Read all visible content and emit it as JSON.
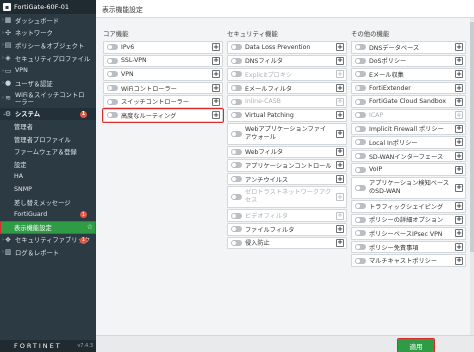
{
  "sidebar": {
    "device": "FortiGate-60F-01",
    "items": [
      {
        "label": "ダッシュボード",
        "icon": "dashboard-icon"
      },
      {
        "label": "ネットワーク",
        "icon": "network-icon"
      },
      {
        "label": "ポリシー＆オブジェクト",
        "icon": "policy-icon"
      },
      {
        "label": "セキュリティプロファイル",
        "icon": "shield-icon"
      },
      {
        "label": "VPN",
        "icon": "vpn-icon"
      },
      {
        "label": "ユーザ＆認証",
        "icon": "user-icon"
      },
      {
        "label": "WiFi＆スイッチコントローラー",
        "icon": "wifi-icon"
      }
    ],
    "system": {
      "label": "システム",
      "badge": "1"
    },
    "system_sub": [
      "管理者",
      "管理者プロファイル",
      "ファームウェア＆登録",
      "設定",
      "HA",
      "SNMP",
      "差し替えメッセージ",
      "FortiGuard"
    ],
    "fortiguard_badge": "1",
    "current": "表示機能設定",
    "bottom": [
      {
        "label": "セキュリティファブリック",
        "icon": "fabric-icon",
        "badge": "1"
      },
      {
        "label": "ログ＆レポート",
        "icon": "log-icon"
      }
    ],
    "footer_logo": "FORTINET",
    "version": "v7.4.3"
  },
  "main": {
    "title": "表示機能設定",
    "columns": [
      {
        "title": "コア機能",
        "features": [
          {
            "label": "IPv6",
            "on": false,
            "disabled": false
          },
          {
            "label": "SSL-VPN",
            "on": false,
            "disabled": false
          },
          {
            "label": "VPN",
            "on": false,
            "disabled": false
          },
          {
            "label": "WiFiコントローラー",
            "on": false,
            "disabled": false
          },
          {
            "label": "スイッチコントローラー",
            "on": false,
            "disabled": false
          },
          {
            "label": "高度なルーティング",
            "on": false,
            "disabled": false,
            "highlight": true
          }
        ]
      },
      {
        "title": "セキュリティ機能",
        "features": [
          {
            "label": "Data Loss Prevention",
            "on": false,
            "disabled": false
          },
          {
            "label": "DNSフィルタ",
            "on": false,
            "disabled": false
          },
          {
            "label": "Explicitプロキシ",
            "on": false,
            "disabled": true
          },
          {
            "label": "Eメールフィルタ",
            "on": false,
            "disabled": false
          },
          {
            "label": "Inline-CASB",
            "on": false,
            "disabled": true
          },
          {
            "label": "Virtual Patching",
            "on": false,
            "disabled": false
          },
          {
            "label": "Webアプリケーションファイアウォール",
            "on": false,
            "disabled": false,
            "two_line": true
          },
          {
            "label": "Webフィルタ",
            "on": false,
            "disabled": false
          },
          {
            "label": "アプリケーションコントロール",
            "on": false,
            "disabled": false
          },
          {
            "label": "アンチウイルス",
            "on": false,
            "disabled": false
          },
          {
            "label": "ゼロトラストネットワークアクセス",
            "on": false,
            "disabled": true,
            "two_line": true
          },
          {
            "label": "ビデオフィルタ",
            "on": false,
            "disabled": true
          },
          {
            "label": "ファイルフィルタ",
            "on": false,
            "disabled": false
          },
          {
            "label": "侵入防止",
            "on": false,
            "disabled": false
          }
        ]
      },
      {
        "title": "その他の機能",
        "features": [
          {
            "label": "DNSデータベース",
            "on": false,
            "disabled": false
          },
          {
            "label": "DoSポリシー",
            "on": false,
            "disabled": false
          },
          {
            "label": "Eメール収集",
            "on": false,
            "disabled": false
          },
          {
            "label": "FortiExtender",
            "on": false,
            "disabled": false
          },
          {
            "label": "FortiGate Cloud Sandbox",
            "on": false,
            "disabled": false
          },
          {
            "label": "ICAP",
            "on": false,
            "disabled": true
          },
          {
            "label": "Implicit Firewall ポリシー",
            "on": false,
            "disabled": false
          },
          {
            "label": "Local Inポリシー",
            "on": false,
            "disabled": false
          },
          {
            "label": "SD-WANインターフェース",
            "on": false,
            "disabled": false
          },
          {
            "label": "VoIP",
            "on": false,
            "disabled": false
          },
          {
            "label": "アプリケーション検知ベースのSD-WAN",
            "on": false,
            "disabled": false,
            "two_line": true
          },
          {
            "label": "トラフィックシェイピング",
            "on": false,
            "disabled": false
          },
          {
            "label": "ポリシーの詳細オプション",
            "on": false,
            "disabled": false
          },
          {
            "label": "ポリシーベースIPsec VPN",
            "on": false,
            "disabled": false
          },
          {
            "label": "ポリシー免責事項",
            "on": false,
            "disabled": false
          },
          {
            "label": "マルチキャストポリシー",
            "on": false,
            "disabled": false
          }
        ]
      }
    ],
    "apply_label": "適用"
  },
  "colors": {
    "sidebar_bg": "#2c3a43",
    "accent_green": "#2f9b45",
    "highlight_red": "#d92b2b"
  }
}
